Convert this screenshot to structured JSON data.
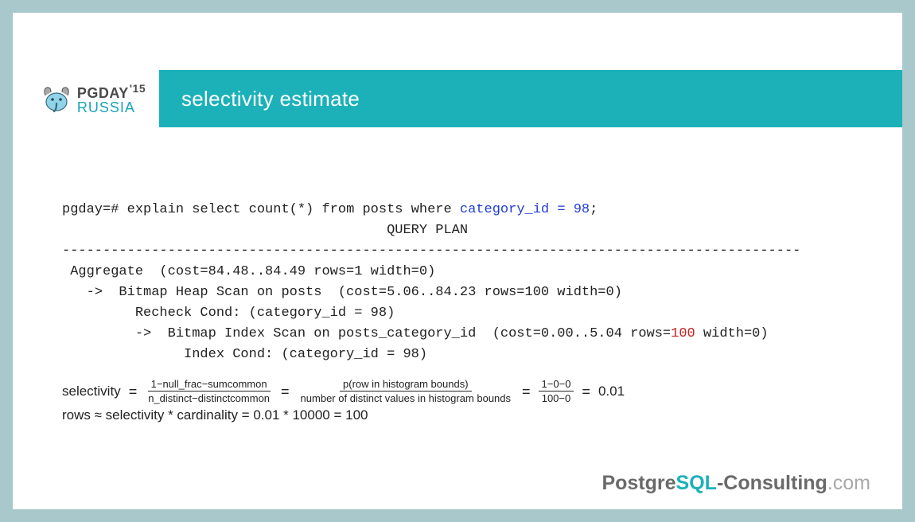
{
  "logo": {
    "line1": "PGDAY",
    "year": "'15",
    "line2": "RUSSIA"
  },
  "title": "selectivity estimate",
  "code": {
    "prompt": "pgday=# ",
    "sql_pre": "explain select count(*) from posts where ",
    "sql_cond": "category_id = 98",
    "sql_post": ";",
    "plan_header": "                                        QUERY PLAN",
    "dashes": "-------------------------------------------------------------------------------------------",
    "l1": " Aggregate  (cost=84.48..84.49 rows=1 width=0)",
    "l2": "   ->  Bitmap Heap Scan on posts  (cost=5.06..84.23 rows=100 width=0)",
    "l3": "         Recheck Cond: (category_id = 98)",
    "l4_pre": "         ->  Bitmap Index Scan on posts_category_id  (cost=0.00..5.04 rows=",
    "l4_hl": "100",
    "l4_post": " width=0)",
    "l5": "               Index Cond: (category_id = 98)"
  },
  "formula": {
    "sel_label": "selectivity",
    "f1_num": "1−null_frac−sumcommon",
    "f1_den": "n_distinct−distinctcommon",
    "f2_num": "p(row in histogram bounds)",
    "f2_den": "number of distinct values in histogram bounds",
    "f3_num": "1−0−0",
    "f3_den": "100−0",
    "sel_result": "0.01",
    "rows_line": "rows ≈ selectivity * cardinality = 0.01 * 10000 = 100"
  },
  "footer": {
    "p1": "Postgre",
    "p2": "SQL",
    "p3": "-Consulting",
    "p4": ".com"
  }
}
